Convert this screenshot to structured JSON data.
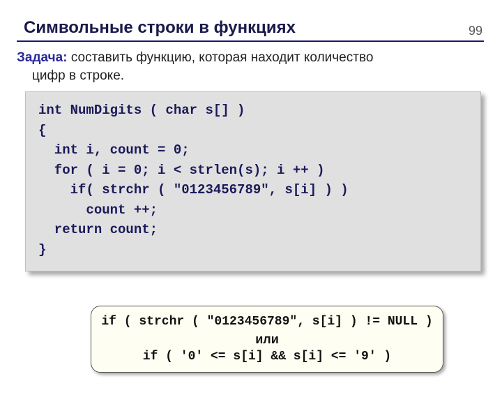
{
  "page_number": "99",
  "title": "Символьные строки в функциях",
  "task": {
    "label": "Задача:",
    "line1": " составить функцию, которая находит количество",
    "line2": "цифр в строке."
  },
  "code": {
    "l1": "int NumDigits ( char s[] )",
    "l2": "{",
    "l3": "  int i, count = 0;",
    "l4": "  for ( i = 0; i < strlen(s); i ++ )",
    "l5": "    if( strchr ( \"0123456789\", s[i] ) )",
    "l6": "      count ++;",
    "l7": "  return count;",
    "l8": "}"
  },
  "callout": {
    "line1": "if ( strchr ( \"0123456789\", s[i] ) != NULL )",
    "or": "или",
    "line2": "if ( '0' <= s[i] && s[i] <= '9' )"
  }
}
